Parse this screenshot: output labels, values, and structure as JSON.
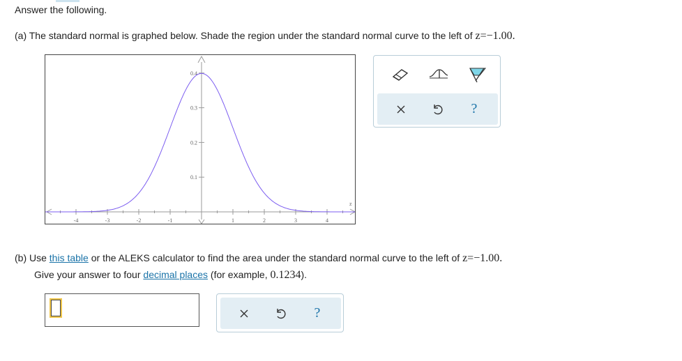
{
  "header": {
    "title": "Answer the following."
  },
  "part_a": {
    "prefix": "(a) The standard normal is graphed below. Shade the region under the standard normal curve to the left of ",
    "math": "z=−1.00."
  },
  "graph": {
    "y_ticks": [
      "0.4",
      "0.3",
      "0.2",
      "0.1"
    ],
    "x_ticks": [
      "-4",
      "-3",
      "-2",
      "-1",
      "1",
      "2",
      "3",
      "4"
    ],
    "x_axis_label": "z",
    "curve_color": "#7b5cf0",
    "axis_color": "#9a9a9a"
  },
  "graph_tools": {
    "items": [
      {
        "name": "eraser-icon"
      },
      {
        "name": "curve-boundary-icon"
      },
      {
        "name": "shade-region-icon"
      }
    ],
    "actions": [
      {
        "name": "clear-icon",
        "symbol": "×"
      },
      {
        "name": "undo-icon",
        "symbol": "↺"
      },
      {
        "name": "help-icon",
        "symbol": "?"
      }
    ],
    "accent": "#7fd6e8"
  },
  "part_b": {
    "line1_prefix": "(b) Use ",
    "link_table": "this table",
    "line1_mid": " or the ALEKS calculator to find the area under the standard normal curve to the left of ",
    "line1_math": "z=−1.00.",
    "line2_prefix": "Give your answer to four ",
    "link_decimal": "decimal places",
    "line2_mid": " (for example, ",
    "line2_math": "0.1234",
    "line2_suffix": ")."
  },
  "answer": {
    "value": "",
    "actions": [
      {
        "name": "clear-icon",
        "symbol": "×"
      },
      {
        "name": "undo-icon",
        "symbol": "↺"
      },
      {
        "name": "help-icon",
        "symbol": "?"
      }
    ]
  }
}
